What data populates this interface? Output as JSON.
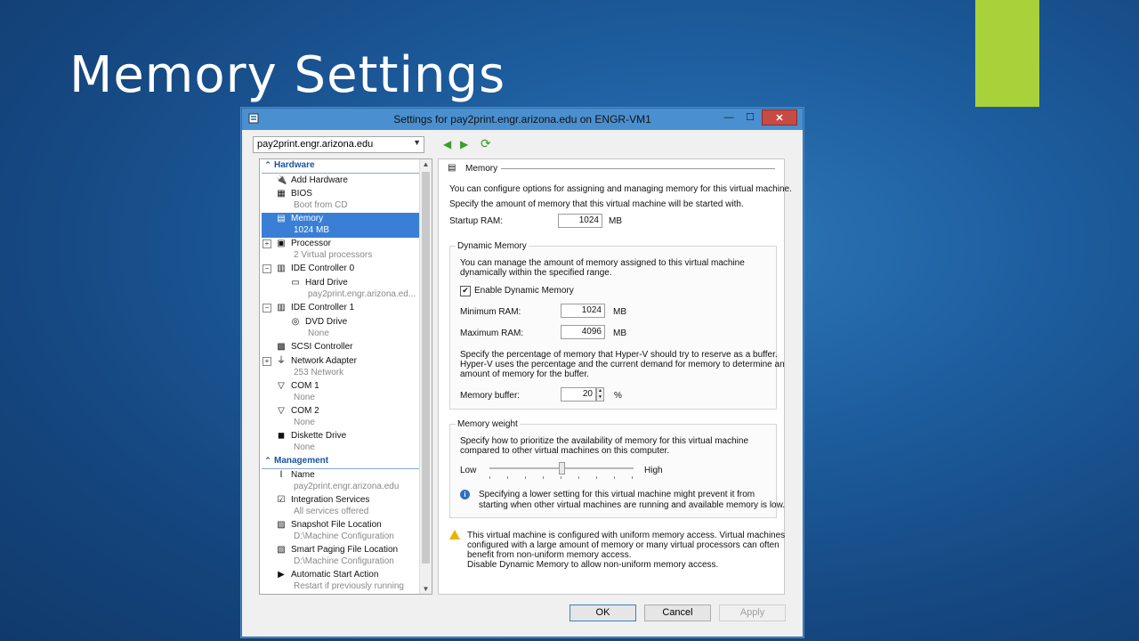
{
  "slide": {
    "title": "Memory Settings"
  },
  "window": {
    "title": "Settings for pay2print.engr.arizona.edu on ENGR-VM1",
    "minimize": "—",
    "maximize": "☐",
    "close": "✕"
  },
  "vm_select": {
    "value": "pay2print.engr.arizona.edu"
  },
  "tree": {
    "hardware_section": "Hardware",
    "management_section": "Management",
    "items": [
      {
        "label": "Add Hardware",
        "sub": ""
      },
      {
        "label": "BIOS",
        "sub": "Boot from CD"
      },
      {
        "label": "Memory",
        "sub": "1024 MB"
      },
      {
        "label": "Processor",
        "sub": "2 Virtual processors"
      },
      {
        "label": "IDE Controller 0",
        "sub": ""
      },
      {
        "label": "Hard Drive",
        "sub": "pay2print.engr.arizona.ed..."
      },
      {
        "label": "IDE Controller 1",
        "sub": ""
      },
      {
        "label": "DVD Drive",
        "sub": "None"
      },
      {
        "label": "SCSI Controller",
        "sub": ""
      },
      {
        "label": "Network Adapter",
        "sub": "253 Network"
      },
      {
        "label": "COM 1",
        "sub": "None"
      },
      {
        "label": "COM 2",
        "sub": "None"
      },
      {
        "label": "Diskette Drive",
        "sub": "None"
      },
      {
        "label": "Name",
        "sub": "pay2print.engr.arizona.edu"
      },
      {
        "label": "Integration Services",
        "sub": "All services offered"
      },
      {
        "label": "Snapshot File Location",
        "sub": "D:\\Machine Configuration"
      },
      {
        "label": "Smart Paging File Location",
        "sub": "D:\\Machine Configuration"
      },
      {
        "label": "Automatic Start Action",
        "sub": "Restart if previously running"
      }
    ]
  },
  "detail": {
    "header": "Memory",
    "intro1": "You can configure options for assigning and managing memory for this virtual machine.",
    "intro2": "Specify the amount of memory that this virtual machine will be started with.",
    "startup_label": "Startup RAM:",
    "startup_value": "1024",
    "unit": "MB",
    "dynamic": {
      "caption": "Dynamic Memory",
      "desc1": "You can manage the amount of memory assigned to this virtual machine",
      "desc2": "dynamically within the specified range.",
      "enable_label": "Enable Dynamic Memory",
      "enabled": true,
      "min_label": "Minimum RAM:",
      "min_value": "1024",
      "max_label": "Maximum RAM:",
      "max_value": "4096",
      "buffer_desc1": "Specify the percentage of memory that Hyper-V should try to reserve as a buffer.",
      "buffer_desc2": "Hyper-V uses the percentage and the current demand for memory to determine an",
      "buffer_desc3": "amount of memory for the buffer.",
      "buffer_label": "Memory buffer:",
      "buffer_value": "20",
      "percent": "%"
    },
    "weight": {
      "caption": "Memory weight",
      "desc1": "Specify how to prioritize the availability of memory for this virtual machine",
      "desc2": "compared to other virtual machines on this computer.",
      "low": "Low",
      "high": "High",
      "slider_value": 0.5,
      "info1": "Specifying a lower setting for this virtual machine might prevent it from",
      "info2": "starting when other virtual machines are running and available memory is low."
    },
    "warning": {
      "line1": "This virtual machine is configured with uniform memory access. Virtual machines",
      "line2": "configured with a large amount of memory or many virtual processors can often",
      "line3": "benefit from non-uniform memory access.",
      "line4": "Disable Dynamic Memory to allow non-uniform memory access."
    }
  },
  "buttons": {
    "ok": "OK",
    "cancel": "Cancel",
    "apply": "Apply"
  },
  "colors": {
    "accent_bar": "#a8d13a",
    "selection": "#3a7fd5",
    "close_button": "#c74b45"
  }
}
